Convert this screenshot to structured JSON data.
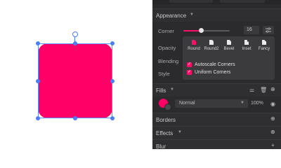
{
  "colors": {
    "shape_fill": "#ff0066",
    "accent": "#ff0f6a",
    "selection": "#4a7dff",
    "panel_bg": "#2b2b2d"
  },
  "appearance": {
    "title": "Appearance",
    "corner_label": "Corner",
    "corner_value": "16",
    "corner_slider_fraction": 0.38,
    "opacity_label": "Opacity",
    "blending_label": "Blending",
    "style_label": "Style",
    "corner_styles": [
      "Round",
      "Round2",
      "Bevel",
      "Inset",
      "Fancy"
    ],
    "options": [
      {
        "label": "Autoscale Corners",
        "checked": true
      },
      {
        "label": "Uniform Corners",
        "checked": true
      }
    ]
  },
  "fills": {
    "title": "Fills",
    "blend_mode": "Normal",
    "opacity": "100%"
  },
  "borders": {
    "title": "Borders"
  },
  "effects": {
    "title": "Effects"
  },
  "blur": {
    "title": "Blur"
  }
}
